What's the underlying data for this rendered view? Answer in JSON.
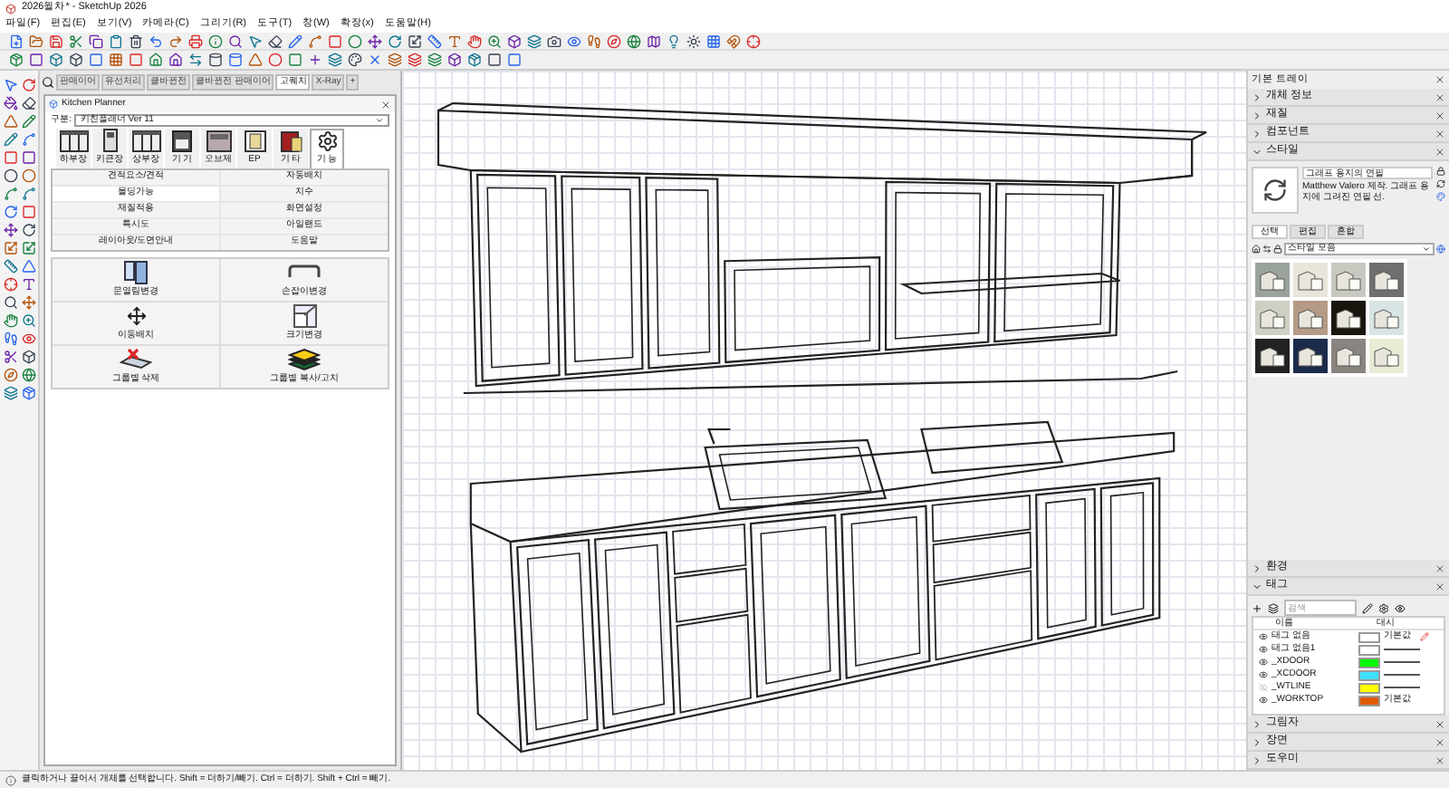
{
  "window": {
    "title": "2026월차* - SketchUp 2026"
  },
  "menu": [
    "파일(F)",
    "편집(E)",
    "보기(V)",
    "카메라(C)",
    "그리기(R)",
    "도구(T)",
    "창(W)",
    "확장(x)",
    "도움말(H)"
  ],
  "document_tabs": [
    {
      "label": "판매이어",
      "selected": false
    },
    {
      "label": "유선처리",
      "selected": false
    },
    {
      "label": "클바뀐전",
      "selected": false
    },
    {
      "label": "클바뀐전 판매이어",
      "selected": false
    },
    {
      "label": "고퀘치",
      "selected": true
    },
    {
      "label": "X-Ray",
      "selected": false
    },
    {
      "label": "+",
      "selected": false
    }
  ],
  "kitchen_planner": {
    "title": "Kitchen Planner",
    "category_label": "구분:",
    "category_value": "키친플래너 Ver 11",
    "modules": [
      {
        "label": "하부장",
        "kind": "cabinet",
        "selected": false
      },
      {
        "label": "키큰장",
        "kind": "tall",
        "selected": false
      },
      {
        "label": "상부장",
        "kind": "cabinet",
        "selected": false
      },
      {
        "label": "기 기",
        "kind": "appliance",
        "selected": false
      },
      {
        "label": "오브제",
        "kind": "object",
        "selected": false
      },
      {
        "label": "EP",
        "kind": "panel",
        "selected": false
      },
      {
        "label": "기 타",
        "kind": "box",
        "selected": false
      },
      {
        "label": "기 능",
        "kind": "gear",
        "selected": true
      }
    ],
    "functions": [
      {
        "label": "견적요소/견적",
        "selected": false
      },
      {
        "label": "자동배치",
        "selected": false
      },
      {
        "label": "몰딩가능",
        "selected": true
      },
      {
        "label": "치수",
        "selected": false
      },
      {
        "label": "재질적용",
        "selected": false
      },
      {
        "label": "화면설정",
        "selected": false
      },
      {
        "label": "특시도",
        "selected": false
      },
      {
        "label": "아일랜드",
        "selected": false
      },
      {
        "label": "레이아웃/도면안내",
        "selected": false
      },
      {
        "label": "도움말",
        "selected": false
      }
    ],
    "actions": [
      {
        "label": "문열림변경",
        "kind": "door"
      },
      {
        "label": "손잡이변경",
        "kind": "handle"
      },
      {
        "label": "이동배치",
        "kind": "move"
      },
      {
        "label": "크기변경",
        "kind": "resize"
      },
      {
        "label": "그룹별 삭제",
        "kind": "delete"
      },
      {
        "label": "그룹별 복사/고치",
        "kind": "copy"
      }
    ]
  },
  "tray": {
    "title": "기본 트레이",
    "panels_top": [
      {
        "label": "개체 정보",
        "expanded": false
      },
      {
        "label": "재질",
        "expanded": false
      },
      {
        "label": "컴포넌트",
        "expanded": false
      },
      {
        "label": "스타일",
        "expanded": true
      }
    ],
    "style": {
      "name": "그래프 용지의 연필",
      "description": "Matthew Valero 제작. 그래프 용지에 그려진 연필 선.",
      "tabs": [
        {
          "label": "선택",
          "selected": true
        },
        {
          "label": "편집",
          "selected": false
        },
        {
          "label": "혼합",
          "selected": false
        }
      ],
      "collection": "스타일 모음"
    },
    "panels_mid": [
      {
        "label": "환경",
        "expanded": false
      },
      {
        "label": "태그",
        "expanded": true
      }
    ],
    "tags": {
      "search_placeholder": "검색",
      "columns": [
        "이름",
        "대시"
      ],
      "rows": [
        {
          "name": "태그 없음",
          "visible": true,
          "color": "#ffffff",
          "dash": "기본값",
          "active": true
        },
        {
          "name": "태그 없음1",
          "visible": true,
          "color": "#ffffff",
          "active": false
        },
        {
          "name": "_XDOOR",
          "visible": true,
          "color": "#00ff00",
          "active": false
        },
        {
          "name": "_XCDOOR",
          "visible": true,
          "color": "#40e0ff",
          "active": false
        },
        {
          "name": "_WTLINE",
          "visible": false,
          "color": "#ffff00",
          "active": false
        },
        {
          "name": "_WORKTOP",
          "visible": true,
          "color": "#e05a00",
          "dash": "기본값",
          "active": false
        }
      ]
    },
    "panels_bottom": [
      {
        "label": "그림자",
        "expanded": false
      },
      {
        "label": "장면",
        "expanded": false
      },
      {
        "label": "도우미",
        "expanded": false
      }
    ]
  },
  "status_bar": {
    "text": "클릭하거나 끌어서 개체를 선택합니다. Shift = 더하기/빼기. Ctrl = 더하기. Shift + Ctrl = 빼기."
  }
}
